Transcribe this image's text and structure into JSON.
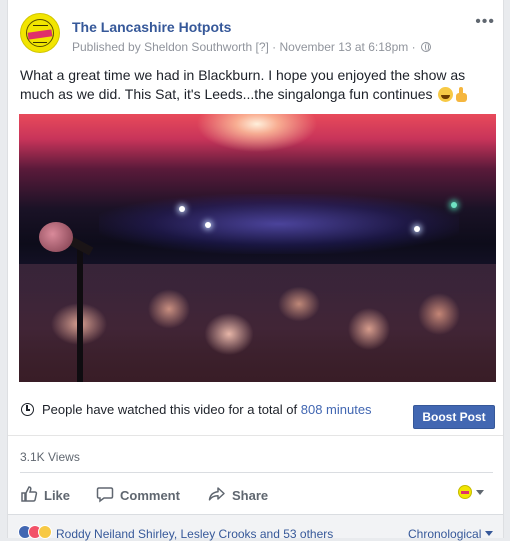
{
  "post": {
    "page_name": "The Lancashire Hotpots",
    "published_prefix": "Published by",
    "publisher": "Sheldon Southworth",
    "help_marker": "[?]",
    "dot1": "·",
    "timestamp": "November 13 at 6:18pm",
    "dot2": "·",
    "more_label": "•••",
    "text": "What a great time we had in Blackburn. I hope you enjoyed the show as much as we did. This Sat, it's Leeds...the singalonga fun continues"
  },
  "stats": {
    "watch_text": "People have watched this video for a total of",
    "watch_minutes": "808 minutes",
    "boost_label": "Boost Post",
    "views": "3.1K Views"
  },
  "actions": {
    "like": "Like",
    "comment": "Comment",
    "share": "Share"
  },
  "footer": {
    "reactors": "Roddy Neiland Shirley, Lesley Crooks and 53 others",
    "order": "Chronological"
  },
  "colors": {
    "link": "#365899",
    "button": "#4267b2",
    "muted": "#90949c"
  },
  "icons": {
    "avatar": "lancashire-hotpots-logo",
    "audience": "globe-icon",
    "clock": "clock-icon",
    "like": "thumbs-up-icon",
    "comment": "speech-bubble-icon",
    "share": "share-arrow-icon"
  }
}
